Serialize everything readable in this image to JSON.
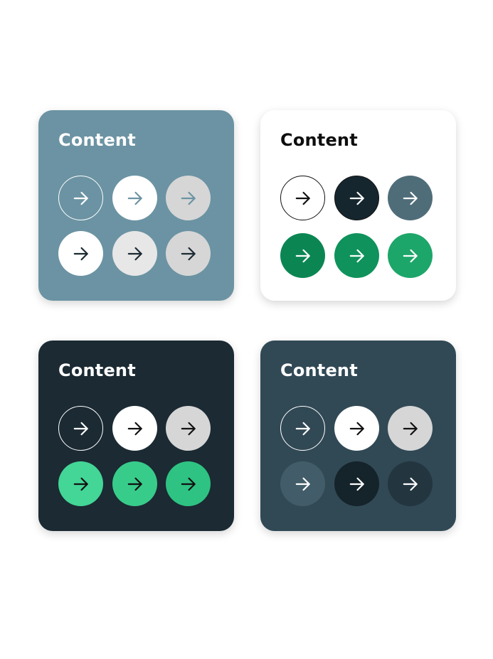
{
  "cards": [
    {
      "title": "Content",
      "background": "#6b93a3",
      "title_color": "#ffffff",
      "buttons": [
        {
          "icon": "arrow-right-icon",
          "fill": "transparent",
          "border": "#ffffff",
          "arrow": "#ffffff"
        },
        {
          "icon": "arrow-right-icon",
          "fill": "#ffffff",
          "border": "none",
          "arrow": "#6b93a3"
        },
        {
          "icon": "arrow-right-icon",
          "fill": "#d6d6d6",
          "border": "none",
          "arrow": "#6b93a3"
        },
        {
          "icon": "arrow-right-icon",
          "fill": "#ffffff",
          "border": "none",
          "arrow": "#1b2a33"
        },
        {
          "icon": "arrow-right-icon",
          "fill": "#e7e7e7",
          "border": "none",
          "arrow": "#1b2a33"
        },
        {
          "icon": "arrow-right-icon",
          "fill": "#d6d6d6",
          "border": "none",
          "arrow": "#1b2a33"
        }
      ]
    },
    {
      "title": "Content",
      "background": "#ffffff",
      "title_color": "#0e0e0e",
      "buttons": [
        {
          "icon": "arrow-right-icon",
          "fill": "#ffffff",
          "border": "#111111",
          "arrow": "#111111"
        },
        {
          "icon": "arrow-right-icon",
          "fill": "#15262e",
          "border": "#111111",
          "arrow": "#ffffff"
        },
        {
          "icon": "arrow-right-icon",
          "fill": "#4f6d79",
          "border": "none",
          "arrow": "#ffffff"
        },
        {
          "icon": "arrow-right-icon",
          "fill": "#0b8653",
          "border": "none",
          "arrow": "#ffffff"
        },
        {
          "icon": "arrow-right-icon",
          "fill": "#0f925b",
          "border": "none",
          "arrow": "#ffffff"
        },
        {
          "icon": "arrow-right-icon",
          "fill": "#1da66a",
          "border": "none",
          "arrow": "#ffffff"
        }
      ]
    },
    {
      "title": "Content",
      "background": "#1b2a33",
      "title_color": "#ffffff",
      "buttons": [
        {
          "icon": "arrow-right-icon",
          "fill": "transparent",
          "border": "#ffffff",
          "arrow": "#ffffff"
        },
        {
          "icon": "arrow-right-icon",
          "fill": "#ffffff",
          "border": "none",
          "arrow": "#111111"
        },
        {
          "icon": "arrow-right-icon",
          "fill": "#d6d6d6",
          "border": "none",
          "arrow": "#111111"
        },
        {
          "icon": "arrow-right-icon",
          "fill": "#43d696",
          "border": "none",
          "arrow": "#111111"
        },
        {
          "icon": "arrow-right-icon",
          "fill": "#38cc8b",
          "border": "none",
          "arrow": "#111111"
        },
        {
          "icon": "arrow-right-icon",
          "fill": "#2ec382",
          "border": "none",
          "arrow": "#111111"
        }
      ]
    },
    {
      "title": "Content",
      "background": "#314955",
      "title_color": "#ffffff",
      "buttons": [
        {
          "icon": "arrow-right-icon",
          "fill": "transparent",
          "border": "#ffffff",
          "arrow": "#ffffff"
        },
        {
          "icon": "arrow-right-icon",
          "fill": "#ffffff",
          "border": "none",
          "arrow": "#111111"
        },
        {
          "icon": "arrow-right-icon",
          "fill": "#d6d6d6",
          "border": "none",
          "arrow": "#111111"
        },
        {
          "icon": "arrow-right-icon",
          "fill": "#425d69",
          "border": "none",
          "arrow": "#ffffff"
        },
        {
          "icon": "arrow-right-icon",
          "fill": "#15232a",
          "border": "none",
          "arrow": "#ffffff"
        },
        {
          "icon": "arrow-right-icon",
          "fill": "#23353f",
          "border": "none",
          "arrow": "#ffffff"
        }
      ]
    }
  ]
}
